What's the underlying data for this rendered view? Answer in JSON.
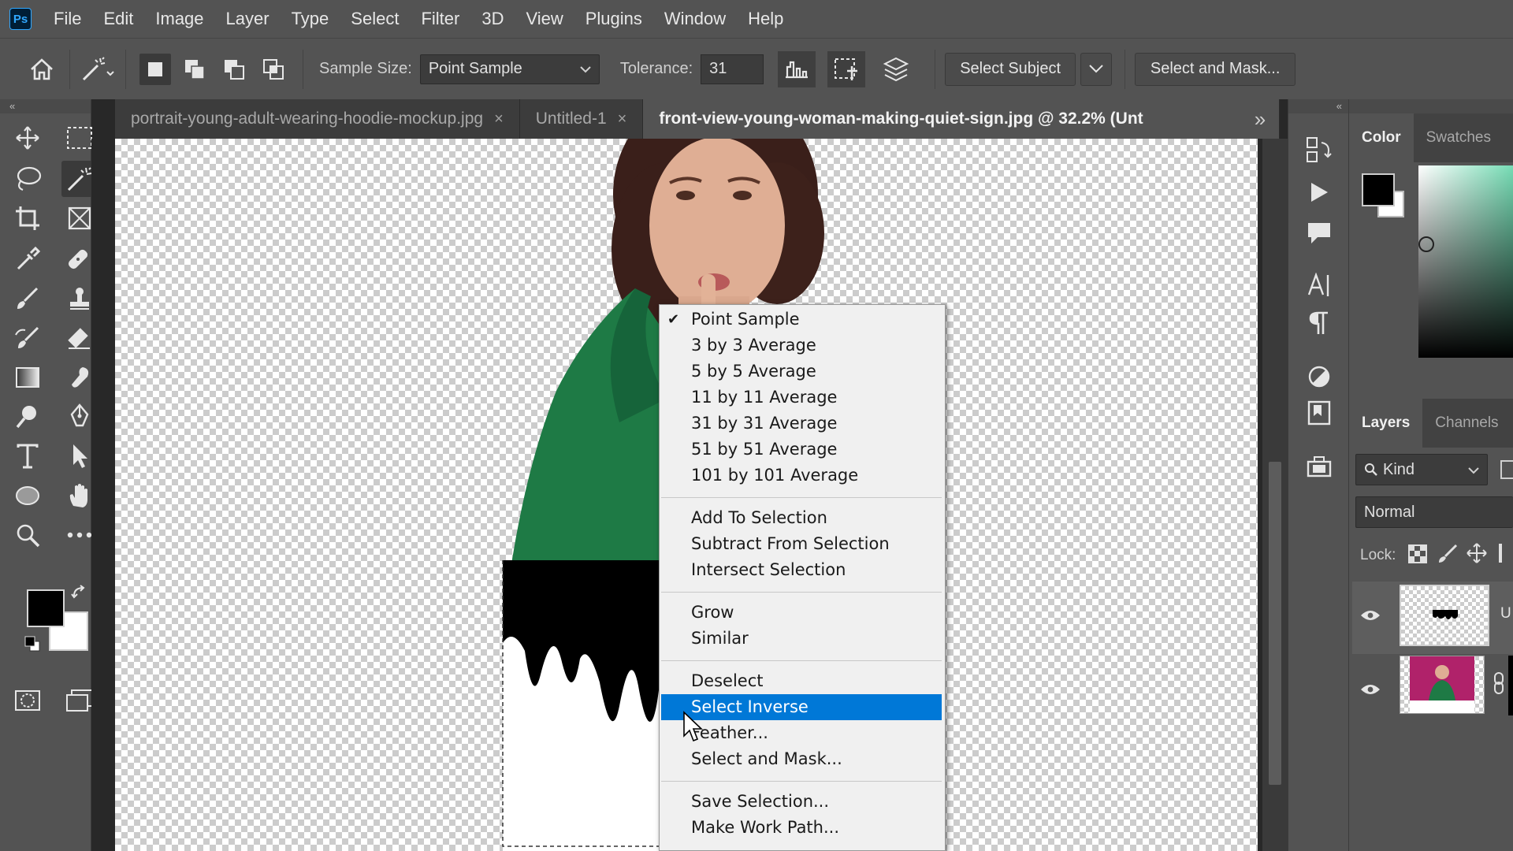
{
  "app": {
    "logo": "Ps"
  },
  "menu": [
    "File",
    "Edit",
    "Image",
    "Layer",
    "Type",
    "Select",
    "Filter",
    "3D",
    "View",
    "Plugins",
    "Window",
    "Help"
  ],
  "options": {
    "sample_size_label": "Sample Size:",
    "sample_size_value": "Point Sample",
    "tolerance_label": "Tolerance:",
    "tolerance_value": "31",
    "select_subject": "Select Subject",
    "select_and_mask": "Select and Mask..."
  },
  "tabs": [
    {
      "title": "portrait-young-adult-wearing-hoodie-mockup.jpg",
      "close": "×"
    },
    {
      "title": "Untitled-1",
      "close": "×"
    },
    {
      "title": "front-view-young-woman-making-quiet-sign.jpg @ 32.2% (Unt"
    }
  ],
  "context_menu": {
    "items_group1": [
      "Point Sample",
      "3 by 3 Average",
      "5 by 5 Average",
      "11 by 11 Average",
      "31 by 31 Average",
      "51 by 51 Average",
      "101 by 101 Average"
    ],
    "checked_item": "Point Sample",
    "items_group2": [
      "Add To Selection",
      "Subtract From Selection",
      "Intersect Selection"
    ],
    "items_group3": [
      "Grow",
      "Similar"
    ],
    "items_group4": [
      "Deselect",
      "Select Inverse",
      "Feather...",
      "Select and Mask..."
    ],
    "highlighted_item": "Select Inverse",
    "items_group5": [
      "Save Selection...",
      "Make Work Path..."
    ]
  },
  "panels": {
    "color_tab": "Color",
    "swatches_tab": "Swatches",
    "layers_tab": "Layers",
    "channels_tab": "Channels",
    "kind_filter": "Kind",
    "blend_mode": "Normal",
    "lock_label": "Lock:",
    "layer1_name_fragment": "U"
  },
  "colors": {
    "accent_highlight": "#0078d7",
    "hoodie": "#1e7a45",
    "ps_blue": "#31a8ff"
  }
}
